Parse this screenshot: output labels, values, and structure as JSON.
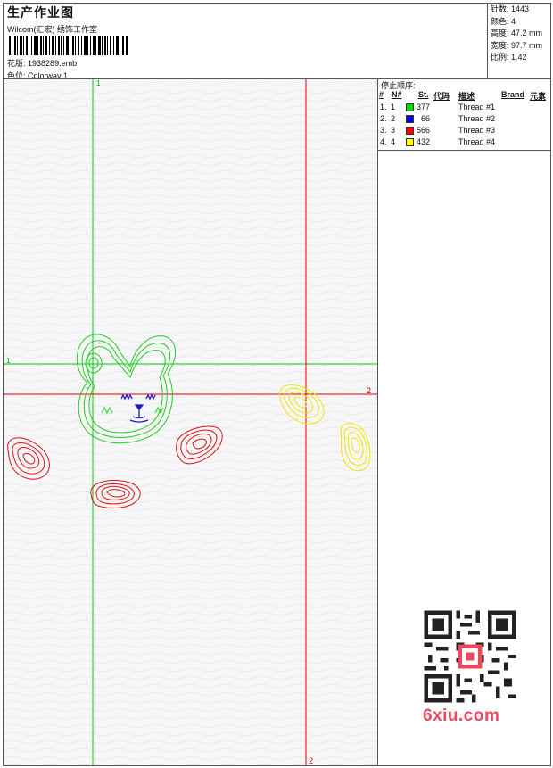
{
  "header": {
    "title": "生产作业图",
    "studio": "Wilcom(汇宏) 绣饰工作室",
    "design_label": "花版:",
    "design_file": "1938289.emb",
    "colorway_label": "色位:",
    "colorway_name": "Colorway 1"
  },
  "stats": {
    "stitches": "针数: 1443",
    "colors": "颜色: 4",
    "height": "高度: 47.2 mm",
    "width": "宽度: 97.7 mm",
    "scale": "比例: 1.42"
  },
  "stop_sequence": {
    "title": "停止顺序:",
    "headers": [
      "#",
      "N#",
      "St.",
      "代码",
      "描述",
      "Brand",
      "元素"
    ],
    "rows": [
      {
        "idx": "1.",
        "n": "1",
        "code": "377",
        "color": "#00dd00",
        "desc": "Thread #1"
      },
      {
        "idx": "2.",
        "n": "2",
        "code": "66",
        "color": "#0000ff",
        "desc": "Thread #2"
      },
      {
        "idx": "3.",
        "n": "3",
        "code": "566",
        "color": "#ff0000",
        "desc": "Thread #3"
      },
      {
        "idx": "4.",
        "n": "4",
        "code": "432",
        "color": "#ffff00",
        "desc": "Thread #4"
      }
    ]
  },
  "guides": {
    "green_v_label": "1",
    "green_h_label": "1",
    "red_h_label": "2",
    "red_v_label": "2"
  },
  "watermark": "6xiu.com"
}
